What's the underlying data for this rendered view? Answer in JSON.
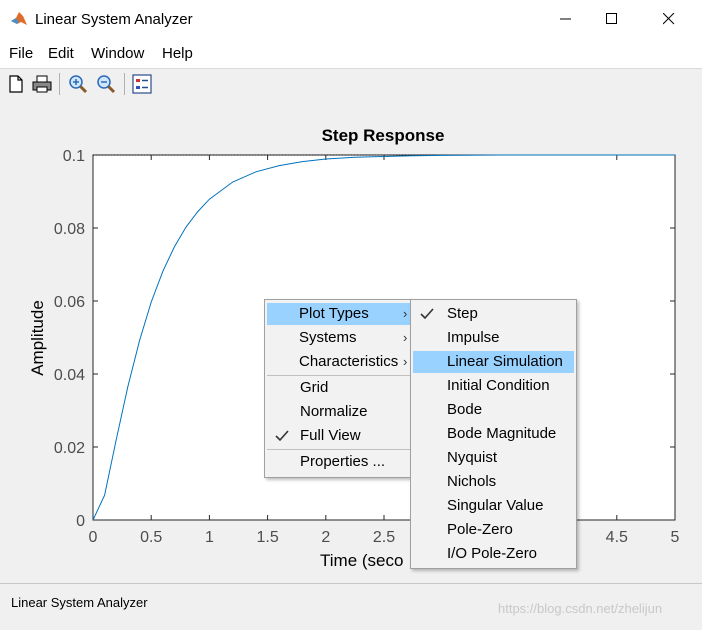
{
  "window": {
    "title": "Linear System Analyzer"
  },
  "menu": [
    "File",
    "Edit",
    "Window",
    "Help"
  ],
  "toolbar": {
    "icons": [
      "new-icon",
      "print-icon",
      "zoom-in-icon",
      "zoom-out-icon",
      "legend-icon"
    ]
  },
  "chart_data": {
    "type": "line",
    "title": "Step Response",
    "xlabel": "Time (seco",
    "ylabel": "Amplitude",
    "xlim": [
      0,
      5
    ],
    "ylim": [
      0,
      0.1
    ],
    "xticks": [
      "0",
      "0.5",
      "1",
      "1.5",
      "2",
      "2.5",
      "4.5",
      "5"
    ],
    "yticks": [
      "0",
      "0.02",
      "0.04",
      "0.06",
      "0.08",
      "0.1"
    ],
    "grid": false,
    "series": [
      {
        "color": "#0072bd",
        "x": [
          0,
          0.1,
          0.2,
          0.3,
          0.4,
          0.5,
          0.6,
          0.7,
          0.8,
          0.9,
          1.0,
          1.2,
          1.4,
          1.6,
          1.8,
          2.0,
          2.25,
          2.5,
          2.75,
          3.0,
          3.5,
          4.0,
          4.5,
          5.0
        ],
        "y": [
          0,
          0.0068,
          0.0221,
          0.0366,
          0.0492,
          0.0597,
          0.0681,
          0.0749,
          0.0803,
          0.0845,
          0.0879,
          0.0926,
          0.0954,
          0.0971,
          0.0982,
          0.0989,
          0.0994,
          0.0996,
          0.0998,
          0.0999,
          0.1,
          0.1,
          0.1,
          0.1
        ]
      }
    ],
    "reference_line": 0.1
  },
  "context_menu": {
    "items": [
      "Plot Types",
      "Systems",
      "Characteristics",
      "Grid",
      "Normalize",
      "Full View",
      "Properties ..."
    ],
    "highlighted": "Plot Types",
    "checked": "Full View"
  },
  "submenu": {
    "items": [
      "Step",
      "Impulse",
      "Linear Simulation",
      "Initial Condition",
      "Bode",
      "Bode Magnitude",
      "Nyquist",
      "Nichols",
      "Singular Value",
      "Pole-Zero",
      "I/O Pole-Zero"
    ],
    "highlighted": "Linear Simulation",
    "checked": "Step"
  },
  "status": "Linear System Analyzer",
  "watermark": "https://blog.csdn.net/zhelijun",
  "colors": {
    "highlight": "#99d1ff",
    "line": "#0072bd"
  }
}
